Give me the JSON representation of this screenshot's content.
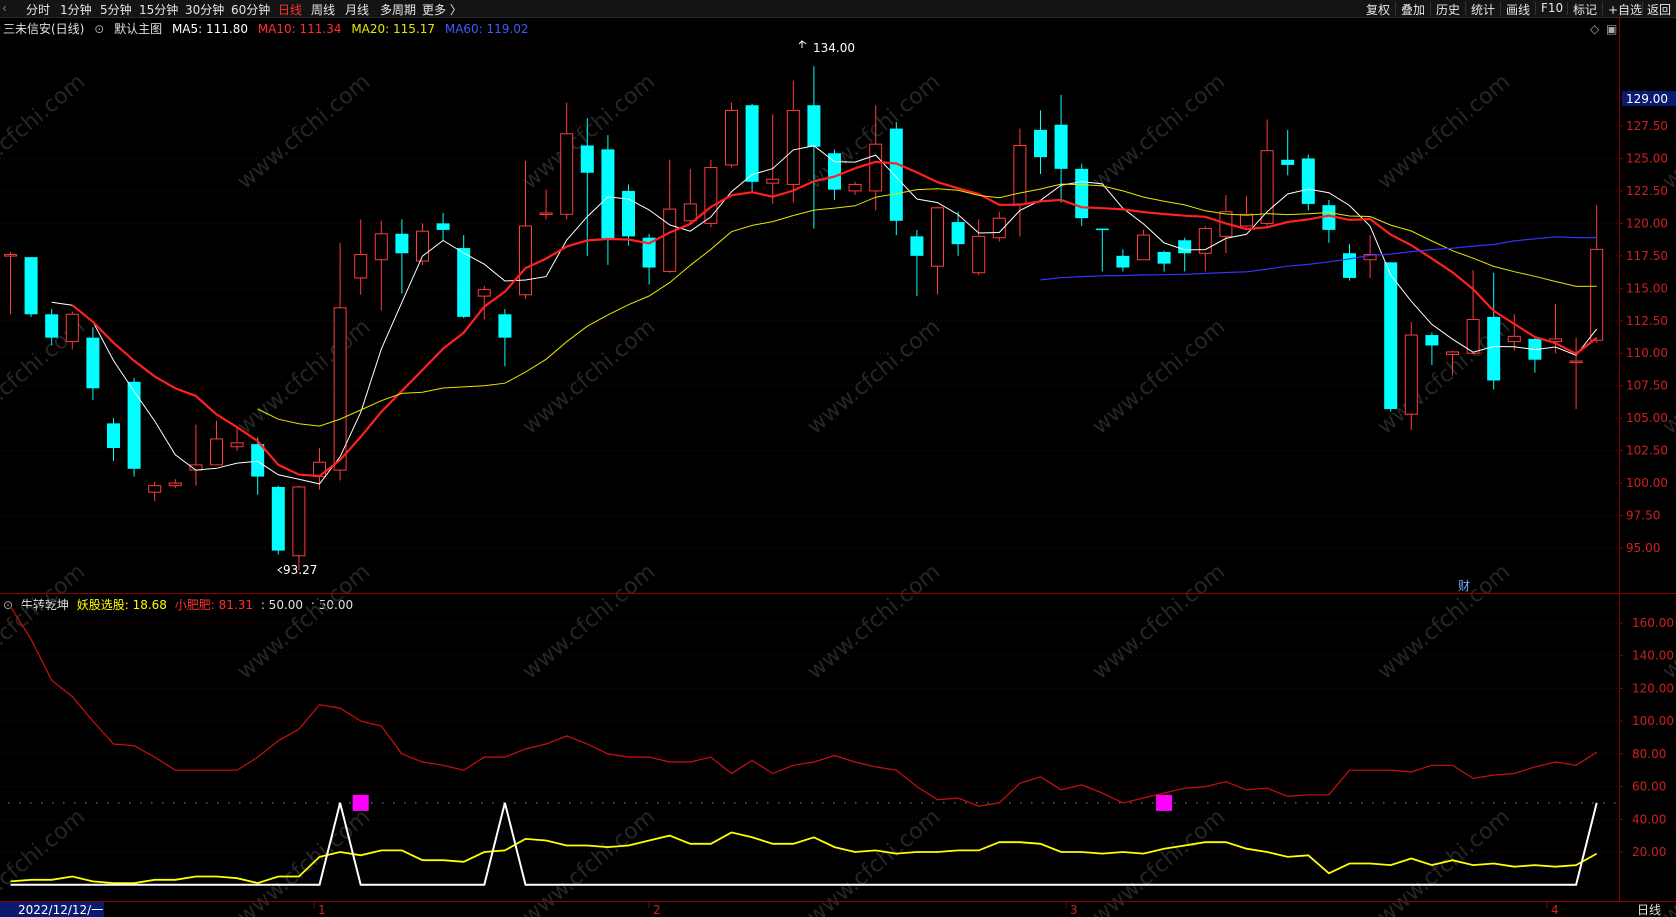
{
  "topbar": {
    "tabs": [
      "分时",
      "1分钟",
      "5分钟",
      "15分钟",
      "30分钟",
      "60分钟",
      "日线",
      "周线",
      "月线",
      "多周期",
      "更多 〉"
    ],
    "active_tab": "日线",
    "right_buttons": [
      "复权",
      "叠加",
      "历史",
      "统计",
      "画线",
      "F10",
      "+自选",
      "返回"
    ],
    "mark_label": "标记",
    "corner_glyph": "‹"
  },
  "main_legend": {
    "stock": "三未信安(日线)",
    "chart_name": "默认主图",
    "ma5": "MA5: 111.80",
    "ma10": "MA10: 111.34",
    "ma20": "MA20: 115.17",
    "ma60": "MA60: 119.02"
  },
  "sub_legend": {
    "name": "牛转乾坤",
    "yaogu": "妖股选股: 18.68",
    "xiaofeifei": "小肥肥: 81.31",
    "v3": ": 50.00",
    "v4": ": 50.00"
  },
  "annotations": {
    "high": "134.00",
    "low": "93.27",
    "price_tag": "129.00",
    "fin_marker": "财"
  },
  "xaxis": {
    "date_label": "2022/12/12/一",
    "months": [
      "1",
      "2",
      "3",
      "4"
    ],
    "period_label": "日线"
  },
  "watermark": "www.cfchi.com",
  "colors": {
    "up": "#ff3b3b",
    "down": "#00ffff",
    "ma5": "#ffffff",
    "ma10": "#ff2020",
    "ma20": "#e6e600",
    "ma60": "#3333ff",
    "grid": "#5a0000",
    "axis": "#8b0000",
    "sub_red": "#cc1010",
    "sub_yellow": "#ffff00",
    "sub_white": "#ffffff",
    "signal": "#ff00ff"
  },
  "chart_data": [
    {
      "type": "candlestick",
      "title": "三未信安(日线)",
      "y_ticks": [
        95.0,
        97.5,
        100.0,
        102.5,
        105.0,
        107.5,
        110.0,
        112.5,
        115.0,
        117.5,
        120.0,
        122.5,
        125.0,
        127.5
      ],
      "ylim": [
        93.0,
        134.5
      ],
      "candles": [
        [
          117.5,
          117.6,
          113.0,
          117.8
        ],
        [
          117.4,
          113.0,
          112.8,
          117.4
        ],
        [
          113.0,
          111.2,
          110.6,
          113.4
        ],
        [
          110.9,
          113.0,
          110.3,
          113.2
        ],
        [
          111.2,
          107.3,
          106.4,
          112.0
        ],
        [
          104.6,
          102.7,
          101.7,
          105.0
        ],
        [
          107.8,
          101.1,
          100.5,
          108.1
        ],
        [
          99.3,
          99.8,
          98.6,
          100.1
        ],
        [
          99.8,
          100.0,
          99.6,
          100.3
        ],
        [
          101.0,
          101.4,
          99.8,
          104.5
        ],
        [
          101.4,
          103.4,
          101.4,
          104.8
        ],
        [
          102.8,
          103.1,
          102.5,
          104.2
        ],
        [
          103.0,
          100.5,
          99.1,
          103.5
        ],
        [
          99.7,
          94.8,
          94.5,
          99.8
        ],
        [
          94.4,
          99.7,
          93.3,
          99.8
        ],
        [
          100.5,
          101.6,
          99.5,
          102.7
        ],
        [
          101.0,
          113.5,
          100.2,
          118.5
        ],
        [
          115.8,
          117.6,
          114.5,
          120.3
        ],
        [
          117.2,
          119.2,
          113.3,
          120.2
        ],
        [
          119.2,
          117.7,
          114.6,
          120.3
        ],
        [
          117.1,
          119.4,
          116.8,
          120.0
        ],
        [
          120.0,
          119.5,
          118.7,
          120.8
        ],
        [
          118.1,
          112.8,
          112.7,
          119.1
        ],
        [
          114.4,
          114.9,
          112.6,
          115.2
        ],
        [
          113.0,
          111.2,
          109.0,
          113.4
        ],
        [
          114.5,
          119.8,
          114.2,
          124.8
        ],
        [
          120.7,
          120.8,
          120.3,
          122.6
        ],
        [
          120.7,
          126.9,
          120.3,
          129.3
        ],
        [
          126.0,
          123.9,
          117.5,
          128.1
        ],
        [
          125.7,
          118.8,
          116.8,
          126.8
        ],
        [
          122.5,
          119.0,
          118.3,
          123.0
        ],
        [
          118.9,
          116.6,
          115.3,
          119.2
        ],
        [
          116.3,
          121.1,
          116.2,
          124.9
        ],
        [
          120.2,
          121.5,
          120.0,
          124.2
        ],
        [
          120.0,
          124.3,
          119.7,
          124.9
        ],
        [
          124.5,
          128.7,
          124.3,
          129.3
        ],
        [
          129.1,
          123.2,
          122.4,
          129.2
        ],
        [
          123.1,
          123.4,
          121.5,
          128.4
        ],
        [
          123.0,
          128.7,
          121.6,
          131.0
        ],
        [
          129.1,
          125.9,
          119.6,
          132.1
        ],
        [
          125.4,
          122.6,
          121.8,
          125.7
        ],
        [
          122.5,
          123.0,
          122.2,
          123.2
        ],
        [
          122.5,
          126.1,
          121.0,
          129.1
        ],
        [
          127.3,
          120.2,
          119.1,
          127.8
        ],
        [
          119.0,
          117.5,
          114.4,
          119.5
        ],
        [
          116.7,
          121.2,
          114.5,
          121.3
        ],
        [
          120.1,
          118.4,
          117.5,
          120.9
        ],
        [
          116.2,
          119.0,
          116.0,
          120.3
        ],
        [
          118.9,
          120.4,
          118.6,
          120.9
        ],
        [
          121.5,
          126.0,
          119.0,
          127.3
        ],
        [
          127.2,
          125.1,
          123.8,
          128.7
        ],
        [
          127.6,
          124.2,
          121.6,
          129.9
        ],
        [
          124.2,
          120.4,
          119.8,
          124.6
        ],
        [
          119.6,
          119.5,
          116.3,
          119.6
        ],
        [
          117.5,
          116.6,
          116.3,
          118.0
        ],
        [
          117.2,
          119.1,
          117.2,
          119.5
        ],
        [
          117.8,
          116.9,
          116.3,
          117.9
        ],
        [
          118.7,
          117.7,
          116.3,
          118.9
        ],
        [
          117.7,
          119.6,
          116.3,
          119.8
        ],
        [
          119.0,
          120.9,
          117.7,
          122.2
        ],
        [
          119.8,
          120.7,
          119.7,
          122.1
        ],
        [
          120.0,
          125.6,
          119.7,
          128.0
        ],
        [
          124.9,
          124.5,
          123.7,
          127.2
        ],
        [
          125.0,
          121.5,
          121.0,
          125.3
        ],
        [
          121.4,
          119.5,
          118.5,
          121.8
        ],
        [
          117.7,
          115.8,
          115.6,
          118.4
        ],
        [
          117.2,
          117.6,
          115.8,
          119.1
        ],
        [
          117.0,
          105.7,
          105.5,
          117.0
        ],
        [
          105.3,
          111.4,
          104.1,
          112.4
        ],
        [
          111.4,
          110.6,
          109.1,
          111.6
        ],
        [
          109.9,
          110.1,
          108.3,
          110.2
        ],
        [
          110.0,
          112.6,
          109.9,
          116.4
        ],
        [
          112.8,
          107.9,
          107.2,
          116.2
        ],
        [
          110.9,
          111.3,
          110.2,
          113.0
        ],
        [
          111.1,
          109.5,
          108.5,
          111.3
        ],
        [
          110.9,
          111.1,
          110.0,
          113.8
        ],
        [
          109.4,
          109.4,
          105.7,
          111.2
        ],
        [
          111.0,
          118.0,
          110.8,
          121.4
        ]
      ],
      "ma_series": [
        {
          "name": "MA5",
          "last": 111.8
        },
        {
          "name": "MA10",
          "last": 111.34
        },
        {
          "name": "MA20",
          "last": 115.17
        },
        {
          "name": "MA60",
          "last": 119.02
        }
      ]
    },
    {
      "type": "line",
      "title": "牛转乾坤",
      "y_ticks": [
        20.0,
        40.0,
        60.0,
        80.0,
        100.0,
        120.0,
        140.0,
        160.0
      ],
      "ylim": [
        0,
        172
      ],
      "reference_line": 50,
      "series": [
        {
          "name": "妖股选股",
          "values": [
            2,
            3,
            3,
            5,
            2,
            1,
            1,
            3,
            3,
            5,
            5,
            4,
            1,
            5,
            5,
            17,
            20,
            18,
            21,
            21,
            15,
            15,
            14,
            20,
            21,
            28,
            27,
            24,
            24,
            23,
            24,
            27,
            30,
            25,
            25,
            32,
            29,
            25,
            25,
            29,
            23,
            20,
            21,
            19,
            20,
            20,
            21,
            21,
            26,
            26,
            25,
            20,
            20,
            19,
            20,
            19,
            22,
            24,
            26,
            26,
            22,
            20,
            17,
            18,
            7,
            13,
            13,
            12,
            16,
            12,
            15,
            12,
            13,
            11,
            12,
            11,
            12,
            19
          ]
        },
        {
          "name": "小肥肥",
          "values": [
            170,
            150,
            125,
            115,
            100,
            86,
            85,
            78,
            70,
            70,
            70,
            70,
            78,
            88,
            95,
            110,
            108,
            100,
            97,
            80,
            75,
            73,
            70,
            78,
            78,
            83,
            86,
            91,
            86,
            80,
            78,
            78,
            75,
            75,
            78,
            68,
            76,
            68,
            73,
            75,
            79,
            75,
            72,
            70,
            60,
            52,
            53,
            48,
            50,
            62,
            66,
            58,
            61,
            56,
            50,
            53,
            56,
            59,
            60,
            63,
            58,
            59,
            54,
            55,
            55,
            70,
            70,
            70,
            69,
            73,
            73,
            65,
            67,
            68,
            72,
            75,
            73,
            81
          ]
        },
        {
          "name": "信号",
          "values": [
            0,
            0,
            0,
            0,
            0,
            0,
            0,
            0,
            0,
            0,
            0,
            0,
            0,
            0,
            0,
            0,
            50,
            0,
            0,
            0,
            0,
            0,
            0,
            0,
            50,
            0,
            0,
            0,
            0,
            0,
            0,
            0,
            0,
            0,
            0,
            0,
            0,
            0,
            0,
            0,
            0,
            0,
            0,
            0,
            0,
            0,
            0,
            0,
            0,
            0,
            0,
            0,
            0,
            0,
            0,
            0,
            0,
            0,
            0,
            0,
            0,
            0,
            0,
            0,
            0,
            0,
            0,
            0,
            0,
            0,
            0,
            0,
            0,
            0,
            0,
            0,
            0,
            50
          ]
        }
      ],
      "signal_markers": [
        17,
        56
      ]
    }
  ]
}
